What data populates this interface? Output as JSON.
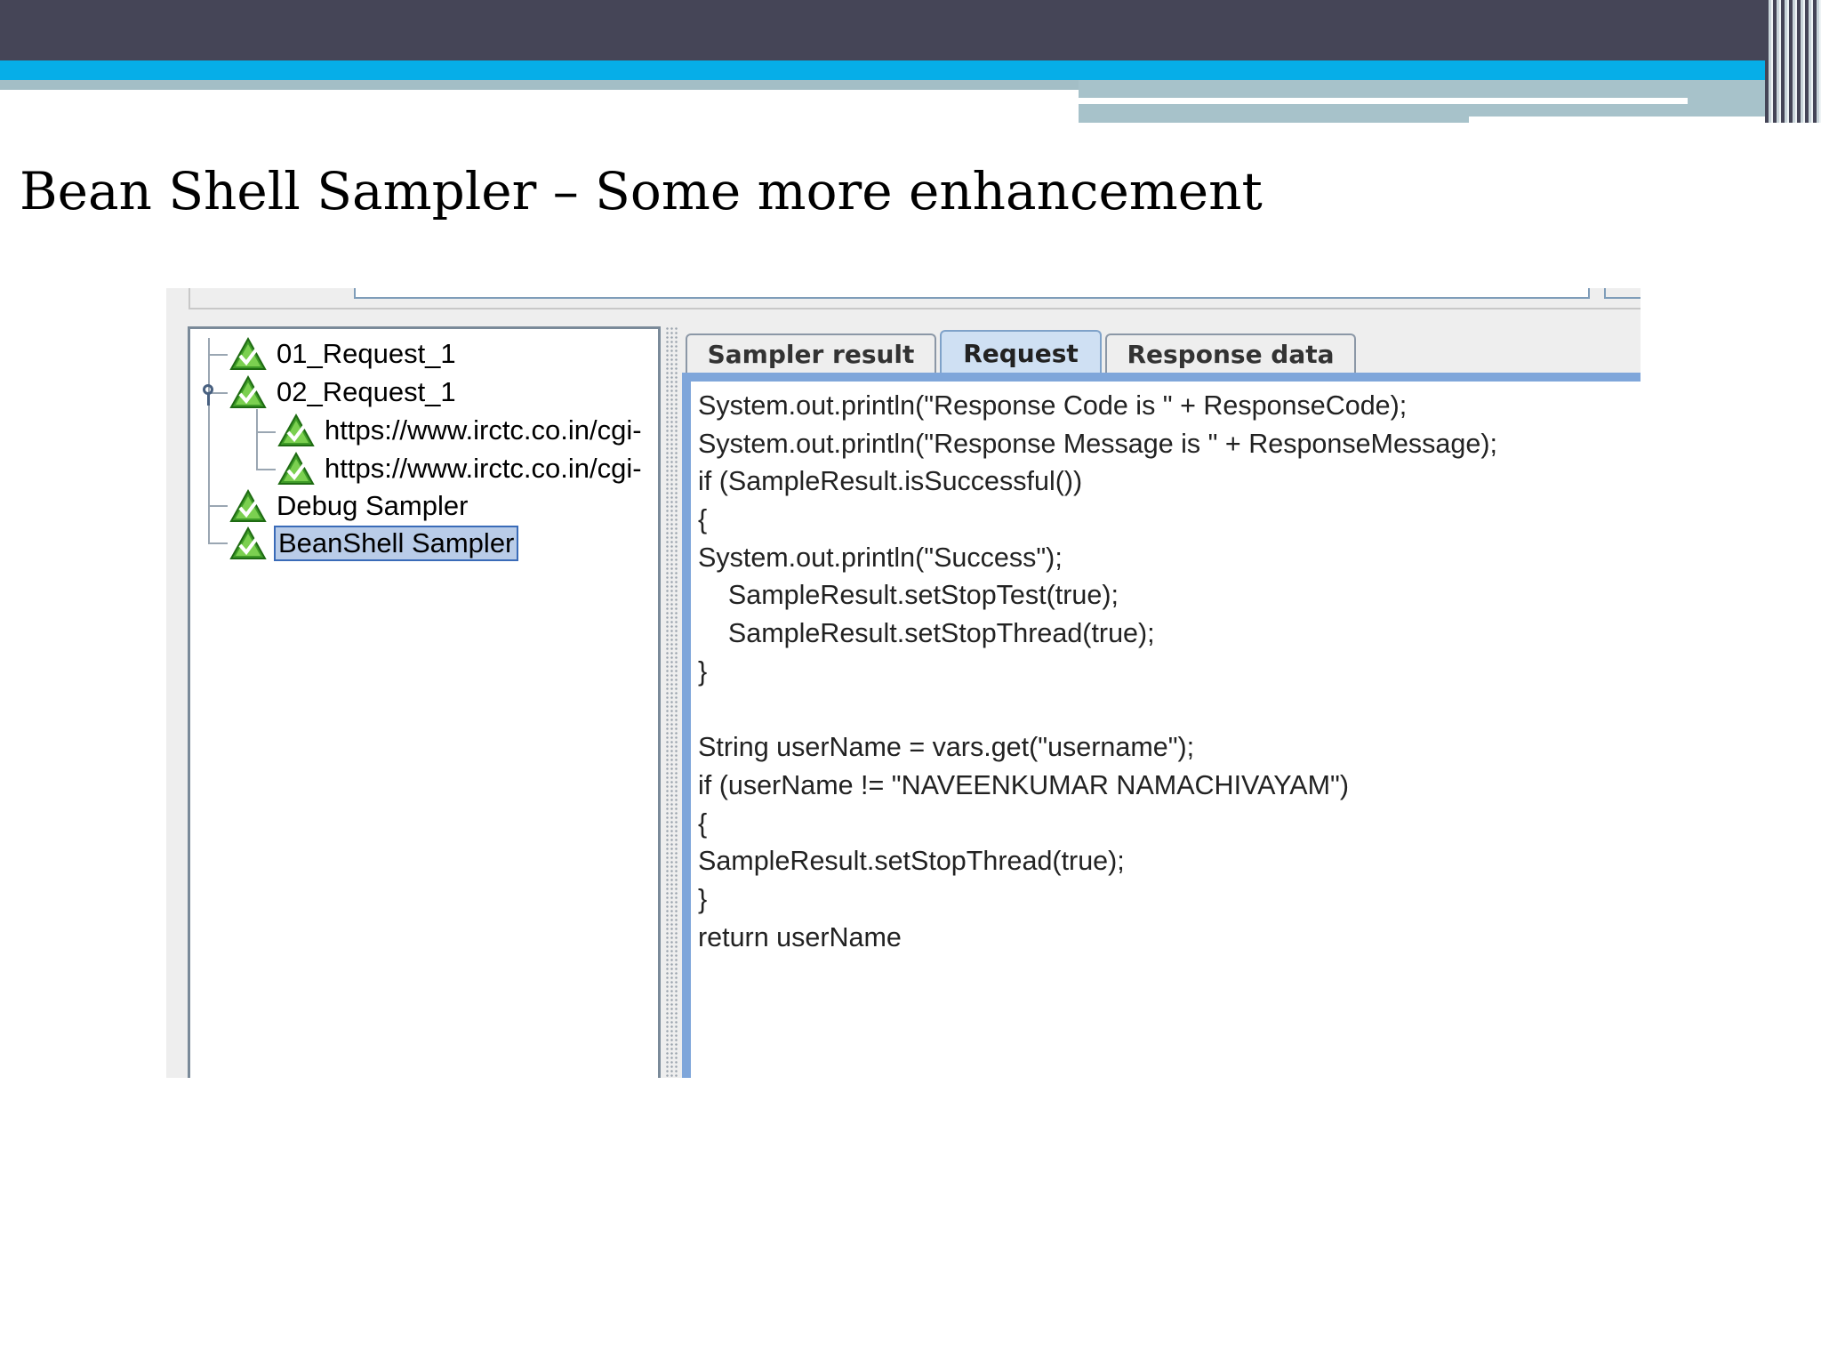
{
  "slide": {
    "title": "Bean Shell Sampler – Some more enhancement"
  },
  "tree": {
    "items": [
      {
        "label": "01_Request_1"
      },
      {
        "label": "02_Request_1"
      },
      {
        "label": "https://www.irctc.co.in/cgi-"
      },
      {
        "label": "https://www.irctc.co.in/cgi-"
      },
      {
        "label": "Debug Sampler"
      },
      {
        "label": "BeanShell Sampler",
        "selected": true
      }
    ],
    "icon": "success-check-triangle-icon"
  },
  "tabs": [
    {
      "label": "Sampler result"
    },
    {
      "label": "Request",
      "active": true
    },
    {
      "label": "Response data"
    }
  ],
  "code": {
    "lines": [
      "System.out.println(\"Response Code is \" + ResponseCode);",
      "System.out.println(\"Response Message is \" + ResponseMessage);",
      "if (SampleResult.isSuccessful())",
      "{",
      "System.out.println(\"Success\");",
      "    SampleResult.setStopTest(true);",
      "    SampleResult.setStopThread(true);",
      "}",
      "",
      "String userName = vars.get(\"username\");",
      "if (userName != \"NAVEENKUMAR NAMACHIVAYAM\")",
      "{",
      "SampleResult.setStopThread(true);",
      "}",
      "return userName"
    ]
  },
  "colors": {
    "header_dark": "#454557",
    "header_blue": "#06aee8",
    "header_gray": "#a7c2ca",
    "active_tab": "#cfe0f3",
    "frame_blue": "#7fa6da",
    "selection": "#b9cce8"
  }
}
